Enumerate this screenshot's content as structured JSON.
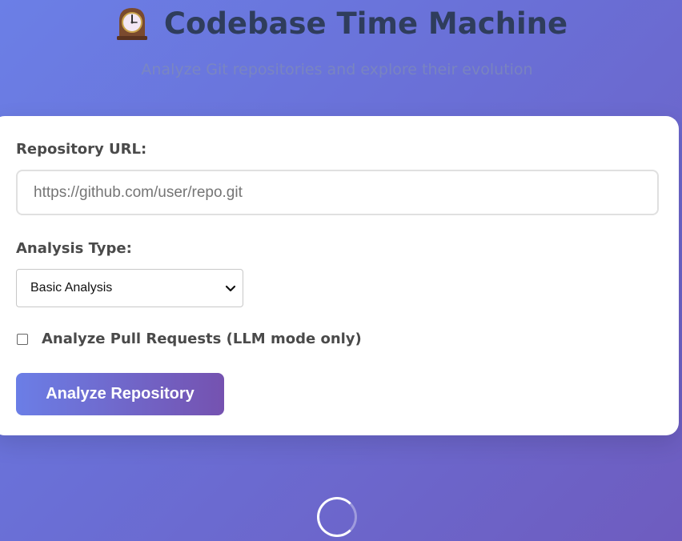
{
  "header": {
    "title": "Codebase Time Machine",
    "subtitle": "Analyze Git repositories and explore their evolution",
    "icon": "mantelpiece-clock-icon"
  },
  "form": {
    "repo_url_label": "Repository URL:",
    "repo_url_placeholder": "https://github.com/user/repo.git",
    "repo_url_value": "",
    "analysis_type_label": "Analysis Type:",
    "analysis_type_selected": "Basic Analysis",
    "pull_requests_label": "Analyze Pull Requests (LLM mode only)",
    "pull_requests_checked": false,
    "submit_label": "Analyze Repository"
  },
  "colors": {
    "background_start": "#6b7fe6",
    "background_end": "#6e5cbf",
    "title_color": "#2f3d5c",
    "button_start": "#6b7ee6",
    "button_end": "#7552b0"
  }
}
